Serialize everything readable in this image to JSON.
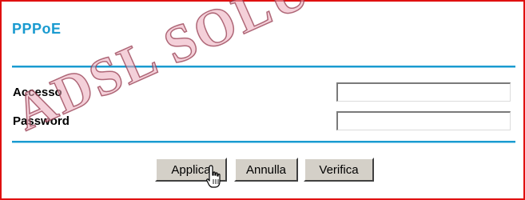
{
  "page": {
    "title": "PPPoE"
  },
  "form": {
    "access_label": "Accesso",
    "access_value": "",
    "password_label": "Password",
    "password_value": ""
  },
  "buttons": {
    "apply": "Applica",
    "cancel": "Annulla",
    "verify": "Verifica"
  },
  "watermark": {
    "text": "ADSL SOLUTION"
  },
  "colors": {
    "accent": "#1a9bd0",
    "frame_border": "#e01010",
    "button_face": "#d4d0c8"
  },
  "icons": {
    "cursor": "hand-pointer-icon"
  }
}
